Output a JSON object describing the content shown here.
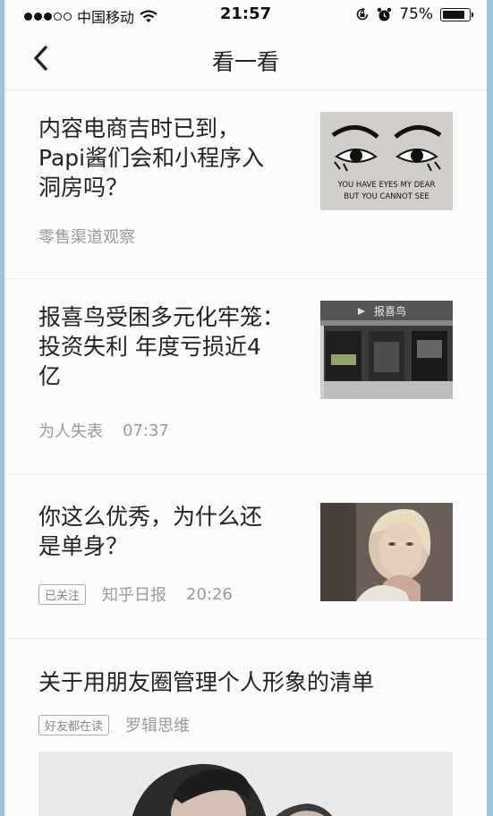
{
  "status_bar": {
    "carrier": "中国移动",
    "time": "21:57",
    "battery": "75%",
    "battery_level": 0.75
  },
  "nav": {
    "title": "看一看",
    "back_icon": "chevron-left-icon"
  },
  "articles": [
    {
      "title_lines": [
        "内容电商吉时已到，",
        "Papi酱们会和小程序入",
        "洞房吗？"
      ],
      "source": "零售渠道观察",
      "image_text": [
        "YOU HAVE EYES MY DEAR",
        "BUT YOU CANNOT SEE"
      ]
    },
    {
      "title_lines": [
        "报喜鸟受困多元化牢笼：",
        "投资失利 年度亏损近4",
        "亿"
      ],
      "source": "为人失表",
      "time": "07:37",
      "image_text": [
        "报喜鸟"
      ]
    },
    {
      "title_lines": [
        "你这么优秀，为什么还",
        "是单身？"
      ],
      "tag": "已关注",
      "source": "知乎日报",
      "time": "20:26"
    },
    {
      "title_lines": [
        "关于用朋友圈管理个人形象的清单"
      ],
      "tag": "好友都在读",
      "source": "罗辑思维"
    }
  ],
  "colors": {
    "background": "#fbfbfb",
    "text": "#222222",
    "meta": "#9a9a9a",
    "frame": "#9cc6e0"
  }
}
